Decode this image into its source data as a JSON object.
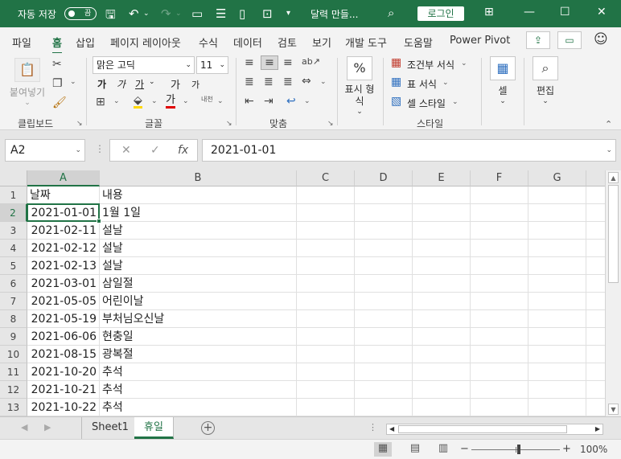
{
  "titlebar": {
    "autosave_label": "자동 저장",
    "autosave_state": "끔",
    "doc_title": "달력 만들...",
    "login": "로그인",
    "accent_color": "#217346"
  },
  "ribbon_tabs": [
    "파일",
    "홈",
    "삽입",
    "페이지 레이아웃",
    "수식",
    "데이터",
    "검토",
    "보기",
    "개발 도구",
    "도움말",
    "Power Pivot"
  ],
  "active_tab": "홈",
  "ribbon": {
    "paste_label": "붙여넣기",
    "clipboard_group": "클립보드",
    "font_name": "맑은 고딕",
    "font_size": "11",
    "font_group": "글꼴",
    "bold": "가",
    "italic": "가",
    "underline": "가",
    "grow_font": "가",
    "shrink_font": "가",
    "font_color_glyph": "가",
    "phonetic": "내천",
    "align_group": "맞춤",
    "number_format_label": "표시 형식",
    "number_icon": "%",
    "conditional_format": "조건부 서식",
    "table_format": "표 서식",
    "cell_styles": "셀 스타일",
    "style_group": "스타일",
    "cells_label": "셀",
    "editing_label": "편집"
  },
  "formula_bar": {
    "name_box": "A2",
    "fx": "fx",
    "value": "2021-01-01"
  },
  "columns": [
    "A",
    "B",
    "C",
    "D",
    "E",
    "F",
    "G"
  ],
  "rows": [
    {
      "n": "1",
      "a": "날짜",
      "b": "내용"
    },
    {
      "n": "2",
      "a": "2021-01-01",
      "b": "1월 1일"
    },
    {
      "n": "3",
      "a": "2021-02-11",
      "b": "설날"
    },
    {
      "n": "4",
      "a": "2021-02-12",
      "b": "설날"
    },
    {
      "n": "5",
      "a": "2021-02-13",
      "b": "설날"
    },
    {
      "n": "6",
      "a": "2021-03-01",
      "b": "삼일절"
    },
    {
      "n": "7",
      "a": "2021-05-05",
      "b": "어린이날"
    },
    {
      "n": "8",
      "a": "2021-05-19",
      "b": "부처님오신날"
    },
    {
      "n": "9",
      "a": "2021-06-06",
      "b": "현충일"
    },
    {
      "n": "10",
      "a": "2021-08-15",
      "b": "광복절"
    },
    {
      "n": "11",
      "a": "2021-10-20",
      "b": "추석"
    },
    {
      "n": "12",
      "a": "2021-10-21",
      "b": "추석"
    },
    {
      "n": "13",
      "a": "2021-10-22",
      "b": "추석"
    }
  ],
  "sheets": [
    "Sheet1",
    "휴일"
  ],
  "active_sheet": "휴일",
  "status": {
    "zoom": "100%",
    "minus": "−",
    "plus": "+"
  }
}
